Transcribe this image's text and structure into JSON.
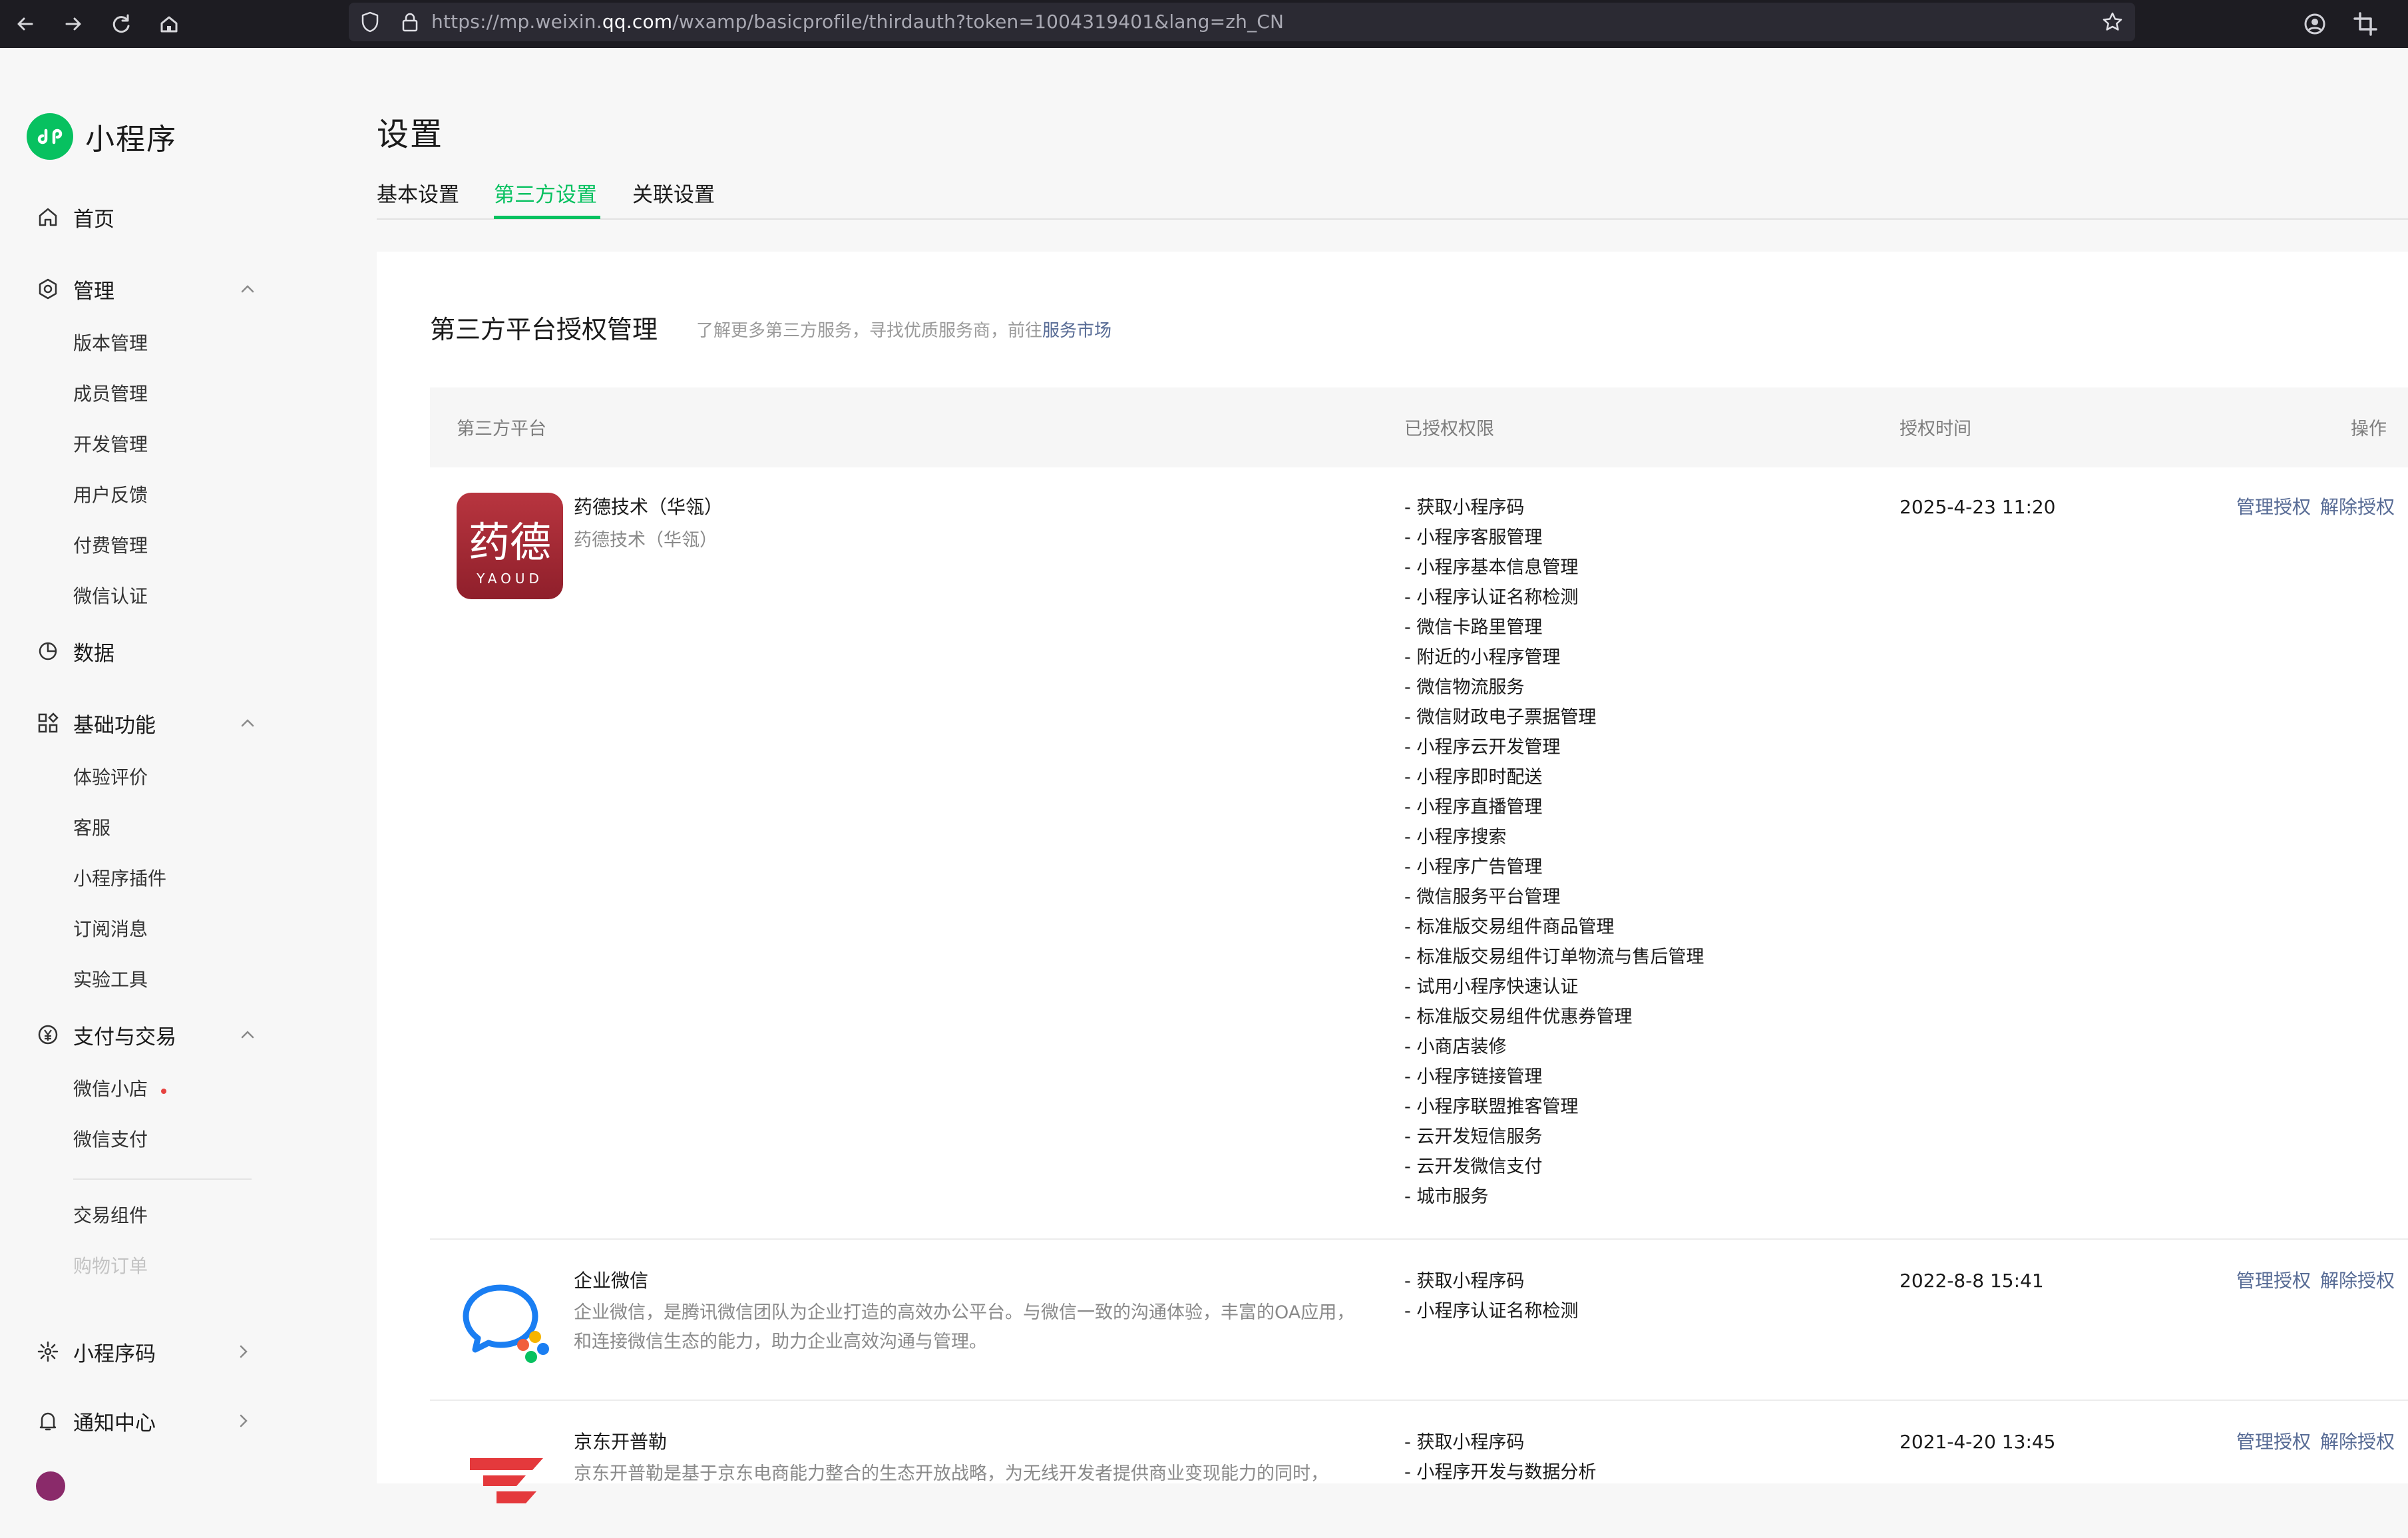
{
  "browser": {
    "url_prefix": "https://mp.weixin.",
    "url_host": "qq.com",
    "url_rest": "/wxamp/basicprofile/thirdauth?token=1004319401&lang=zh_CN"
  },
  "brand": {
    "name": "小程序",
    "color": "#07c160"
  },
  "sidebar": {
    "home": "首页",
    "manage": {
      "label": "管理",
      "items": [
        "版本管理",
        "成员管理",
        "开发管理",
        "用户反馈",
        "付费管理",
        "微信认证"
      ]
    },
    "data": "数据",
    "basic": {
      "label": "基础功能",
      "items": [
        "体验评价",
        "客服",
        "小程序插件",
        "订阅消息",
        "实验工具"
      ]
    },
    "pay": {
      "label": "支付与交易",
      "items": [
        "微信小店",
        "微信支付",
        "交易组件",
        "购物订单"
      ]
    },
    "qrcode": "小程序码",
    "notify": "通知中心"
  },
  "page": {
    "title": "设置",
    "tabs": [
      "基本设置",
      "第三方设置",
      "关联设置"
    ],
    "active_tab": "第三方设置"
  },
  "section": {
    "title": "第三方平台授权管理",
    "desc": "了解更多第三方服务，寻找优质服务商，前往",
    "desc_link": "服务市场"
  },
  "table": {
    "headers": [
      "第三方平台",
      "已授权权限",
      "授权时间",
      "操作"
    ],
    "rows": [
      {
        "name": "药德技术（华瓴）",
        "sub": "药德技术（华瓴）",
        "logo_text": "药德",
        "logo_sub": "YAOUD",
        "permissions": [
          "- 获取小程序码",
          "- 小程序客服管理",
          "- 小程序基本信息管理",
          "- 小程序认证名称检测",
          "- 微信卡路里管理",
          "- 附近的小程序管理",
          "- 微信物流服务",
          "- 微信财政电子票据管理",
          "- 小程序云开发管理",
          "- 小程序即时配送",
          "- 小程序直播管理",
          "- 小程序搜索",
          "- 小程序广告管理",
          "- 微信服务平台管理",
          "- 标准版交易组件商品管理",
          "- 标准版交易组件订单物流与售后管理",
          "- 试用小程序快速认证",
          "- 标准版交易组件优惠券管理",
          "- 小商店装修",
          "- 小程序链接管理",
          "- 小程序联盟推客管理",
          "- 云开发短信服务",
          "- 云开发微信支付",
          "- 城市服务"
        ],
        "time": "2025-4-23 11:20",
        "ops": [
          "管理授权",
          "解除授权"
        ]
      },
      {
        "name": "企业微信",
        "desc": "企业微信，是腾讯微信团队为企业打造的高效办公平台。与微信一致的沟通体验，丰富的OA应用，和连接微信生态的能力，助力企业高效沟通与管理。",
        "permissions": [
          "- 获取小程序码",
          "- 小程序认证名称检测"
        ],
        "time": "2022-8-8 15:41",
        "ops": [
          "管理授权",
          "解除授权"
        ]
      },
      {
        "name": "京东开普勒",
        "desc": "京东开普勒是基于京东电商能力整合的生态开放战略，为无线开发者提供商业变现能力的同时，",
        "permissions": [
          "- 获取小程序码",
          "- 小程序开发与数据分析"
        ],
        "time": "2021-4-20 13:45",
        "ops": [
          "管理授权",
          "解除授权"
        ]
      }
    ]
  }
}
